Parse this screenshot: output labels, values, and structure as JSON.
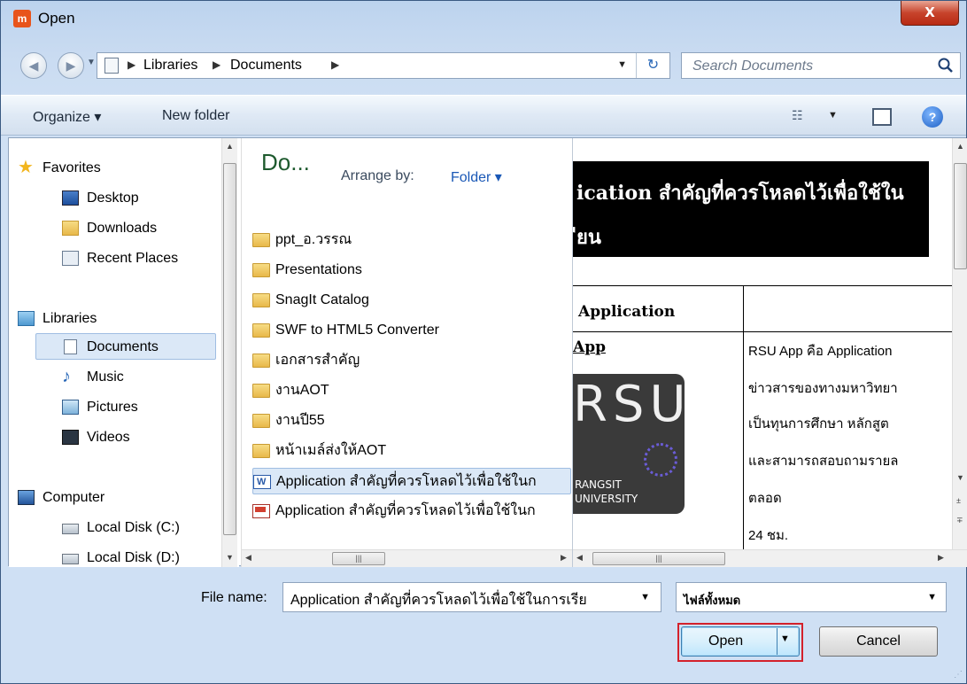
{
  "window": {
    "title": "Open",
    "app_icon": "m",
    "close_glyph": "X"
  },
  "address": {
    "crumbs": [
      "Libraries",
      "Documents"
    ],
    "search_placeholder": "Search Documents"
  },
  "toolbar": {
    "organize": "Organize ▾",
    "new_folder": "New folder"
  },
  "nav": {
    "favorites": "Favorites",
    "desktop": "Desktop",
    "downloads": "Downloads",
    "recent": "Recent Places",
    "libraries": "Libraries",
    "documents": "Documents",
    "music": "Music",
    "pictures": "Pictures",
    "videos": "Videos",
    "computer": "Computer",
    "disk_c": "Local Disk (C:)",
    "disk_d": "Local Disk (D:)"
  },
  "filelist": {
    "title": "Do...",
    "arrange_label": "Arrange by:",
    "arrange_value": "Folder ▾",
    "files": [
      "ppt_อ.วรรณ",
      "Presentations",
      "SnagIt Catalog",
      "SWF to HTML5 Converter",
      "เอกสารสำคัญ",
      "งานAOT",
      "งานปี55",
      "หน้าเมล์ส่งให้AOT",
      "Application สำคัญที่ควรโหลดไว้เพื่อใช้ในก",
      "Application สำคัญที่ควรโหลดไว้เพื่อใช้ในก"
    ]
  },
  "preview": {
    "black_line1": "ication สำคัญที่ควรโหลดไว้เพื่อใช้ใน",
    "black_line2": "ียน",
    "col_head": "Application",
    "app_link": "App",
    "logo_big": "RSU",
    "logo_t1": "RANGSIT",
    "logo_t2": "UNIVERSITY",
    "lines": [
      "RSU App คือ Application",
      "ข่าวสารของทางมหาวิทยา",
      "เป็นทุนการศึกษา หลักสูต",
      "และสามารถสอบถามรายล",
      "ตลอด",
      "24 ชม."
    ]
  },
  "bottom": {
    "filename_label": "File name:",
    "filename_value": "Application สำคัญที่ควรโหลดไว้เพื่อใช้ในการเรีย",
    "filetype_value": "ไฟล์ทั้งหมด",
    "open": "Open",
    "cancel": "Cancel"
  }
}
